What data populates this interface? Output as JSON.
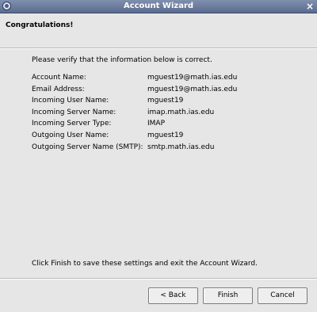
{
  "window": {
    "title": "Account Wizard",
    "close_glyph": "×"
  },
  "header": {
    "heading": "Congratulations!"
  },
  "body": {
    "intro": "Please verify that the information below is correct.",
    "rows": [
      {
        "label": "Account Name:",
        "value": "mguest19@math.ias.edu"
      },
      {
        "label": "Email Address:",
        "value": "mguest19@math.ias.edu"
      },
      {
        "label": "Incoming User Name:",
        "value": "mguest19"
      },
      {
        "label": "Incoming Server Name:",
        "value": "imap.math.ias.edu"
      },
      {
        "label": "Incoming Server Type:",
        "value": "IMAP"
      },
      {
        "label": "Outgoing User Name:",
        "value": "mguest19"
      },
      {
        "label": "Outgoing Server Name (SMTP):",
        "value": "smtp.math.ias.edu"
      }
    ],
    "footer_text": "Click Finish to save these settings and exit the Account Wizard."
  },
  "buttons": {
    "back": "< Back",
    "finish": "Finish",
    "cancel": "Cancel"
  },
  "icons": {
    "app": "app-icon",
    "close": "close-icon"
  },
  "colors": {
    "titlebar": "#6a7b9e",
    "background": "#e6e6e6"
  }
}
